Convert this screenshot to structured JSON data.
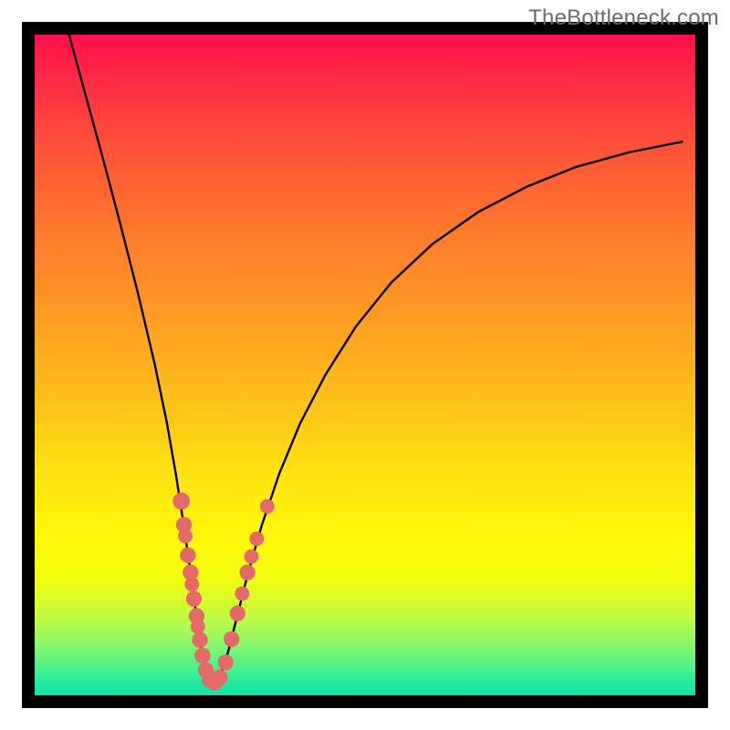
{
  "watermark": "TheBottleneck.com",
  "colors": {
    "curve": "#000000",
    "dot": "#e46a6a",
    "border": "#000000"
  },
  "chart_data": {
    "type": "line",
    "title": "",
    "xlabel": "",
    "ylabel": "",
    "xlim": [
      0,
      1
    ],
    "ylim": [
      0,
      1
    ],
    "grid": false,
    "legend": false,
    "note": "Axes are unlabeled. Values are normalized [0,1] within the gradient plot area; y=0 is the top of the green band, y=1 is the top red edge. Curve is V-shaped with a sharp minimum near x≈0.26; right branch asymptotes near y≈0.84.",
    "curve_points": [
      {
        "x": 0.052,
        "y": 1.0
      },
      {
        "x": 0.078,
        "y": 0.905
      },
      {
        "x": 0.104,
        "y": 0.81
      },
      {
        "x": 0.13,
        "y": 0.712
      },
      {
        "x": 0.156,
        "y": 0.61
      },
      {
        "x": 0.182,
        "y": 0.5
      },
      {
        "x": 0.2,
        "y": 0.413
      },
      {
        "x": 0.214,
        "y": 0.333
      },
      {
        "x": 0.224,
        "y": 0.268
      },
      {
        "x": 0.234,
        "y": 0.2
      },
      {
        "x": 0.242,
        "y": 0.14
      },
      {
        "x": 0.249,
        "y": 0.09
      },
      {
        "x": 0.255,
        "y": 0.052
      },
      {
        "x": 0.26,
        "y": 0.028
      },
      {
        "x": 0.266,
        "y": 0.016
      },
      {
        "x": 0.274,
        "y": 0.018
      },
      {
        "x": 0.283,
        "y": 0.035
      },
      {
        "x": 0.294,
        "y": 0.07
      },
      {
        "x": 0.307,
        "y": 0.122
      },
      {
        "x": 0.323,
        "y": 0.185
      },
      {
        "x": 0.343,
        "y": 0.255
      },
      {
        "x": 0.37,
        "y": 0.335
      },
      {
        "x": 0.402,
        "y": 0.412
      },
      {
        "x": 0.44,
        "y": 0.485
      },
      {
        "x": 0.486,
        "y": 0.558
      },
      {
        "x": 0.54,
        "y": 0.625
      },
      {
        "x": 0.602,
        "y": 0.683
      },
      {
        "x": 0.672,
        "y": 0.732
      },
      {
        "x": 0.745,
        "y": 0.77
      },
      {
        "x": 0.82,
        "y": 0.8
      },
      {
        "x": 0.9,
        "y": 0.822
      },
      {
        "x": 0.98,
        "y": 0.838
      }
    ],
    "dots": [
      {
        "x": 0.222,
        "y": 0.294,
        "r": 0.013
      },
      {
        "x": 0.226,
        "y": 0.258,
        "r": 0.012
      },
      {
        "x": 0.228,
        "y": 0.241,
        "r": 0.011
      },
      {
        "x": 0.232,
        "y": 0.212,
        "r": 0.012
      },
      {
        "x": 0.236,
        "y": 0.186,
        "r": 0.012
      },
      {
        "x": 0.238,
        "y": 0.168,
        "r": 0.011
      },
      {
        "x": 0.241,
        "y": 0.146,
        "r": 0.012
      },
      {
        "x": 0.245,
        "y": 0.12,
        "r": 0.012
      },
      {
        "x": 0.247,
        "y": 0.104,
        "r": 0.011
      },
      {
        "x": 0.25,
        "y": 0.084,
        "r": 0.012
      },
      {
        "x": 0.254,
        "y": 0.06,
        "r": 0.012
      },
      {
        "x": 0.259,
        "y": 0.038,
        "r": 0.012
      },
      {
        "x": 0.265,
        "y": 0.023,
        "r": 0.012
      },
      {
        "x": 0.272,
        "y": 0.019,
        "r": 0.012
      },
      {
        "x": 0.28,
        "y": 0.027,
        "r": 0.012
      },
      {
        "x": 0.289,
        "y": 0.05,
        "r": 0.012
      },
      {
        "x": 0.298,
        "y": 0.085,
        "r": 0.012
      },
      {
        "x": 0.307,
        "y": 0.124,
        "r": 0.012
      },
      {
        "x": 0.314,
        "y": 0.154,
        "r": 0.011
      },
      {
        "x": 0.322,
        "y": 0.186,
        "r": 0.012
      },
      {
        "x": 0.328,
        "y": 0.21,
        "r": 0.011
      },
      {
        "x": 0.336,
        "y": 0.237,
        "r": 0.011
      },
      {
        "x": 0.352,
        "y": 0.286,
        "r": 0.011
      }
    ]
  }
}
